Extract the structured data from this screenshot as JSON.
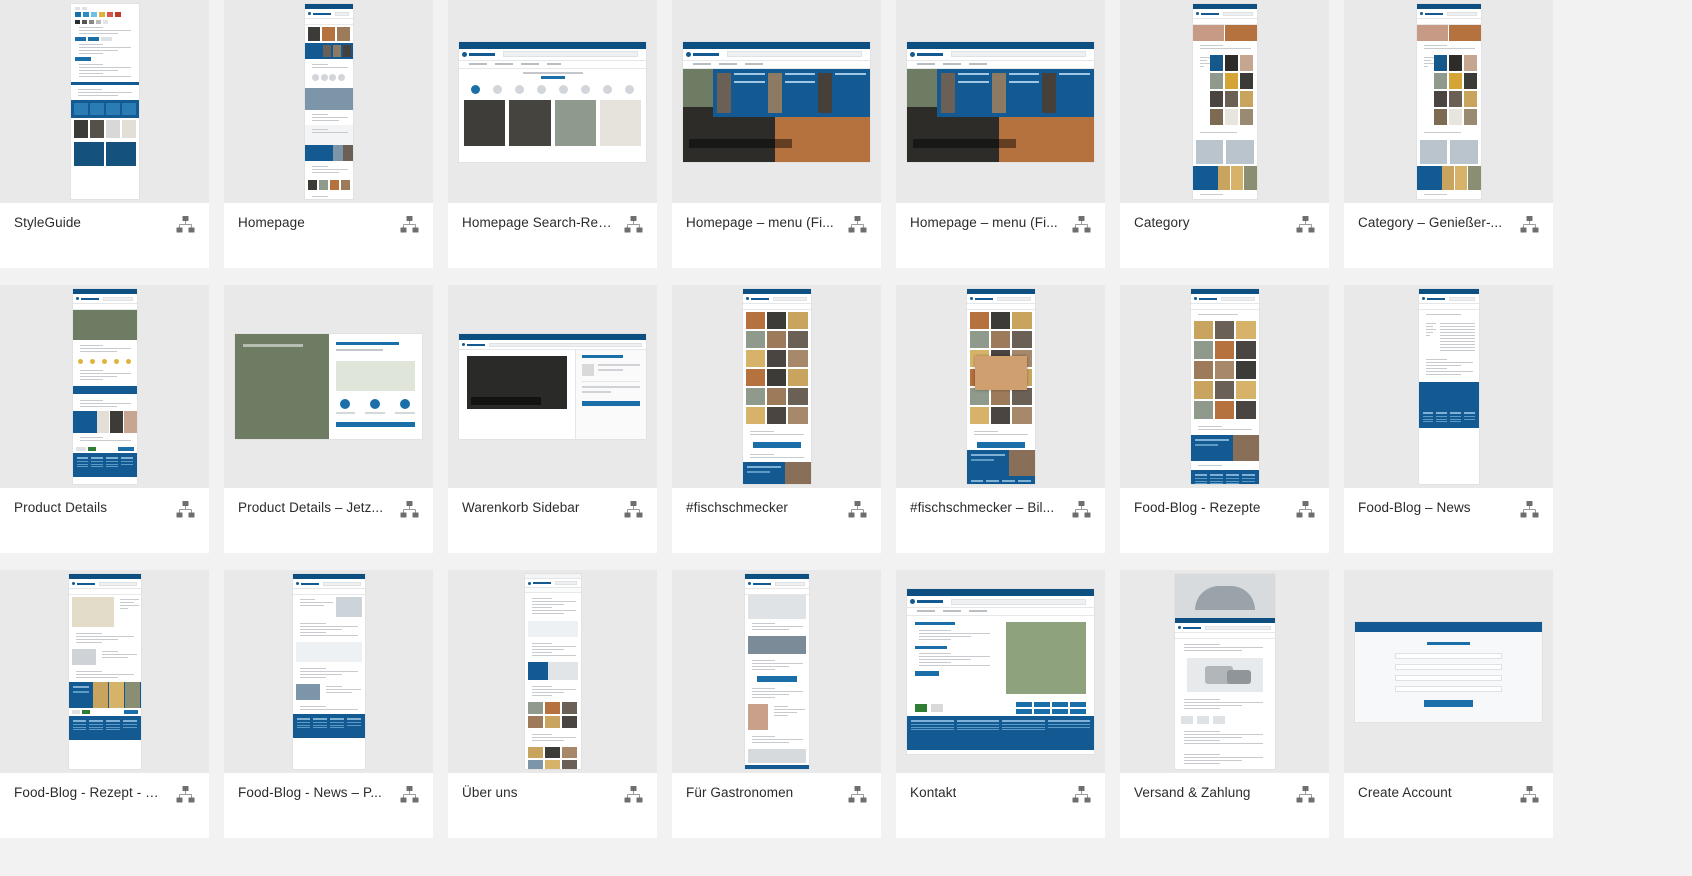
{
  "app": {
    "view": "artboard-gallery",
    "background_color": "#f2f2f2",
    "card_background": "#ffffff",
    "thumb_background": "#e9e9e9",
    "accent_color": "#125a91",
    "icon_color": "#6e6e6e",
    "grid": {
      "columns": 7,
      "rows": 3,
      "card_count": 21
    }
  },
  "icons": {
    "flow": "flow-hierarchy-icon"
  },
  "cards": [
    {
      "label": "StyleGuide",
      "icon": "flow-hierarchy-icon",
      "mock": "styleguide"
    },
    {
      "label": "Homepage",
      "icon": "flow-hierarchy-icon",
      "mock": "homepage"
    },
    {
      "label": "Homepage Search-Res...",
      "icon": "flow-hierarchy-icon",
      "mock": "search-results"
    },
    {
      "label": "Homepage – menu (Fi...",
      "icon": "flow-hierarchy-icon",
      "mock": "menu-open"
    },
    {
      "label": "Homepage – menu (Fi...",
      "icon": "flow-hierarchy-icon",
      "mock": "menu-open-2"
    },
    {
      "label": "Category",
      "icon": "flow-hierarchy-icon",
      "mock": "category"
    },
    {
      "label": "Category – Genießer-...",
      "icon": "flow-hierarchy-icon",
      "mock": "category"
    },
    {
      "label": "Product Details",
      "icon": "flow-hierarchy-icon",
      "mock": "product"
    },
    {
      "label": "Product Details –  Jetz...",
      "icon": "flow-hierarchy-icon",
      "mock": "product-wide"
    },
    {
      "label": "Warenkorb Sidebar",
      "icon": "flow-hierarchy-icon",
      "mock": "cart-sidebar"
    },
    {
      "label": "#fischschmecker",
      "icon": "flow-hierarchy-icon",
      "mock": "hashtag-grid"
    },
    {
      "label": "#fischschmecker – Bil...",
      "icon": "flow-hierarchy-icon",
      "mock": "hashtag-grid-2"
    },
    {
      "label": "Food-Blog - Rezepte",
      "icon": "flow-hierarchy-icon",
      "mock": "blog-recipes"
    },
    {
      "label": "Food-Blog – News",
      "icon": "flow-hierarchy-icon",
      "mock": "blog-news"
    },
    {
      "label": "Food-Blog - Rezept - P...",
      "icon": "flow-hierarchy-icon",
      "mock": "recipe-post"
    },
    {
      "label": "Food-Blog - News – P...",
      "icon": "flow-hierarchy-icon",
      "mock": "news-post"
    },
    {
      "label": "Über uns",
      "icon": "flow-hierarchy-icon",
      "mock": "about"
    },
    {
      "label": "Für Gastronomen",
      "icon": "flow-hierarchy-icon",
      "mock": "gastronomy"
    },
    {
      "label": "Kontakt",
      "icon": "flow-hierarchy-icon",
      "mock": "contact"
    },
    {
      "label": "Versand & Zahlung",
      "icon": "flow-hierarchy-icon",
      "mock": "shipping"
    },
    {
      "label": "Create Account",
      "icon": "flow-hierarchy-icon",
      "mock": "create-account"
    }
  ]
}
